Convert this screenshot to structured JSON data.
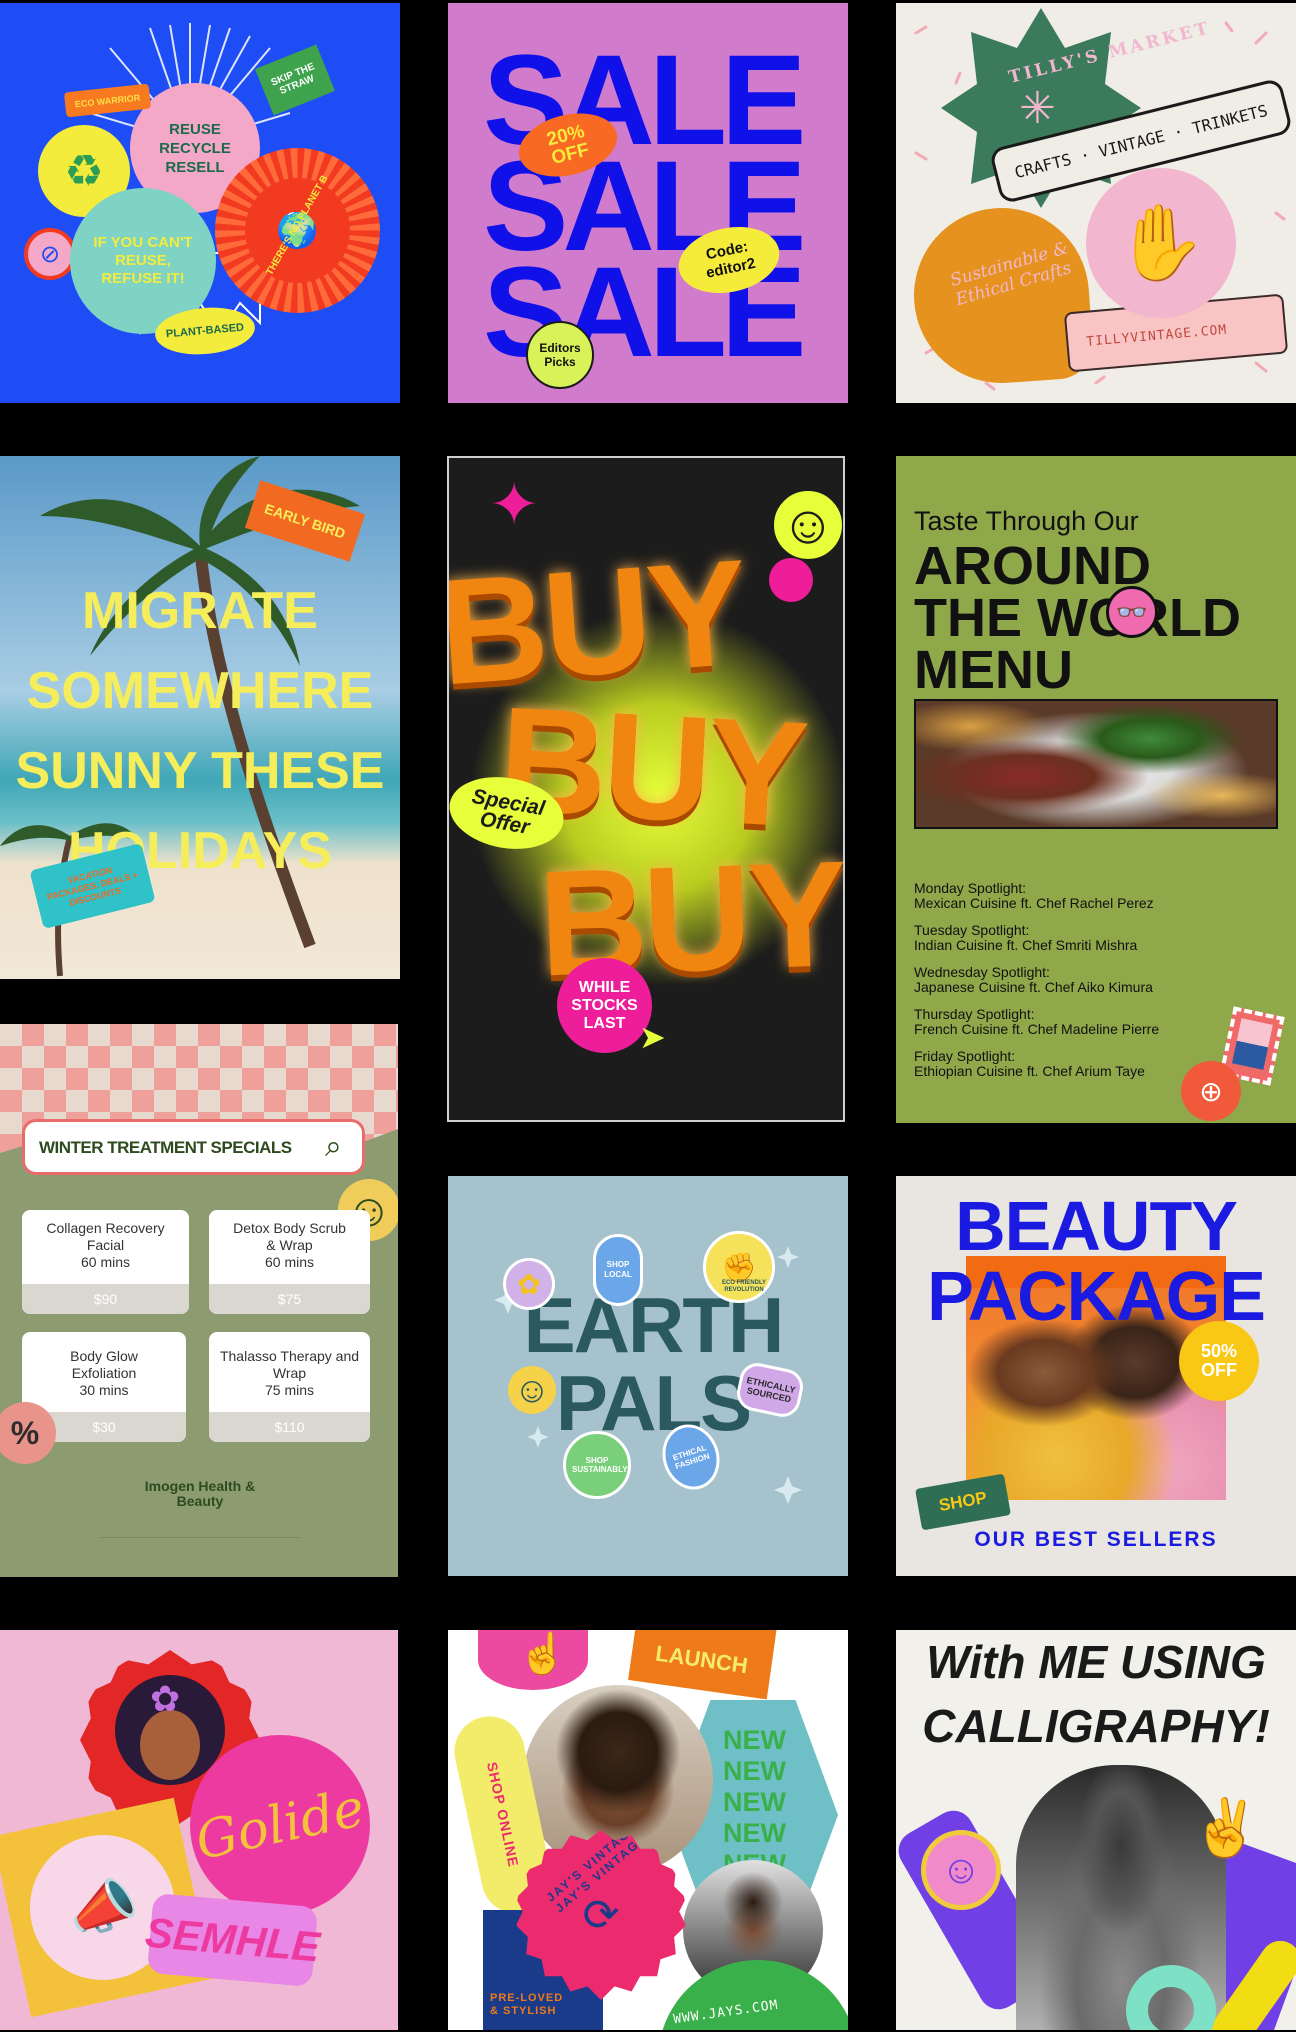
{
  "eco": {
    "colors": {
      "bg": "#1e4cf5",
      "pink": "#f4a8c8",
      "teal": "#7fd3c4",
      "red": "#f23a21",
      "yellow": "#f4ec3c"
    },
    "eco_warrior": "ECO WARRIOR",
    "skip_straw": "SKIP THE STRAW",
    "reuse": "REUSE RECYCLE RESELL",
    "refuse": "IF YOU CAN'T REUSE, REFUSE IT!",
    "no_planet": "THERE'S NO PLANET B",
    "plant_based": "PLANT-BASED"
  },
  "sale": {
    "colors": {
      "bg": "#d07bcc",
      "blue": "#1010e8",
      "orange": "#f86a24",
      "yellow": "#f5eb3a",
      "lime": "#d9f25a"
    },
    "lines": [
      "SALE",
      "SALE",
      "SALE"
    ],
    "discount": "20% OFF",
    "code": "Code: editor2",
    "picks": "Editors Picks"
  },
  "tilly": {
    "colors": {
      "bg": "#efede6",
      "green": "#3c7a5c",
      "orange": "#e6921e",
      "pink": "#f2b6cf"
    },
    "market": "TILLY'S MARKET",
    "tagline": "CRAFTS · VINTAGE · TRINKETS",
    "sustainable": "Sustainable & Ethical Crafts",
    "url": "TILLYVINTAGE.COM"
  },
  "migrate": {
    "colors": {
      "sky": "#7fb3d6",
      "sea": "#3fa7b6",
      "sand": "#efe2cc",
      "text": "#f5ee5a"
    },
    "early_bird": "EARLY BIRD",
    "lines": [
      "MIGRATE",
      "SOMEWHERE",
      "SUNNY THESE",
      "HOLIDAYS"
    ],
    "packages": "VACATION PACKAGES, DEALS + DISCOUNTS"
  },
  "buy": {
    "colors": {
      "bg": "#1c1c1c",
      "orange": "#f0860f",
      "pink": "#ee1e9a",
      "lime": "#e6ff3a"
    },
    "lines": [
      "BUY",
      "BUY",
      "BUY"
    ],
    "special": "Special Offer",
    "stocks": "WHILE STOCKS LAST"
  },
  "menu": {
    "colors": {
      "bg": "#8fa84a",
      "text": "#111111"
    },
    "subtitle": "Taste Through Our",
    "title_lines": [
      "AROUND",
      "THE WORLD",
      "MENU"
    ],
    "spotlights": [
      {
        "day": "Monday Spotlight:",
        "detail": "Mexican Cuisine ft. Chef Rachel Perez"
      },
      {
        "day": "Tuesday Spotlight:",
        "detail": "Indian Cuisine ft. Chef Smriti Mishra"
      },
      {
        "day": "Wednesday Spotlight:",
        "detail": "Japanese Cuisine ft. Chef Aiko Kimura"
      },
      {
        "day": "Thursday Spotlight:",
        "detail": "French Cuisine ft. Chef Madeline Pierre"
      },
      {
        "day": "Friday Spotlight:",
        "detail": "Ethiopian Cuisine ft. Chef Arium Taye"
      }
    ]
  },
  "winter": {
    "colors": {
      "bg": "#8c9b70",
      "check1": "#f0a09a",
      "check2": "#e8d9cf",
      "green": "#2d4b1e"
    },
    "search_text": "WINTER TREATMENT SPECIALS",
    "treatments": [
      {
        "name": "Collagen Recovery Facial",
        "duration": "60 mins",
        "price": "$90"
      },
      {
        "name": "Detox Body Scrub & Wrap",
        "duration": "60 mins",
        "price": "$75"
      },
      {
        "name": "Body Glow Exfoliation",
        "duration": "30 mins",
        "price": "$30"
      },
      {
        "name": "Thalasso Therapy and Wrap",
        "duration": "75 mins",
        "price": "$110"
      }
    ],
    "percent": "%",
    "brand": "Imogen Health & Beauty"
  },
  "earth": {
    "colors": {
      "bg": "#a6c2cc",
      "text": "#2a5a60"
    },
    "title_lines": [
      "EARTH",
      "PALS"
    ],
    "shop_local": "SHOP LOCAL",
    "revolution": "ECO FRIENDLY REVOLUTION",
    "ethically": "ETHICALLY SOURCED",
    "sustainably": "SHOP SUSTAINABLY",
    "fashion": "ETHICAL FASHION"
  },
  "beauty": {
    "colors": {
      "bg": "#e9e6e1",
      "blue": "#1a1ae0",
      "orange": "#f26a12",
      "yellow": "#f8c814",
      "green": "#2f6e55"
    },
    "title_lines": [
      "BEAUTY",
      "PACKAGE"
    ],
    "discount": "50% OFF",
    "shop": "SHOP",
    "bestsellers": "OUR BEST SELLERS"
  },
  "golide": {
    "colors": {
      "bg": "#f0b8d4",
      "red": "#e32626",
      "pink": "#ec3aa0",
      "yellow": "#f4c23a",
      "violet": "#e987e6"
    },
    "golide": "Golide",
    "semhle": "SEMHLE"
  },
  "jays": {
    "colors": {
      "bg": "#ffffff",
      "pink": "#ec2a6e",
      "teal": "#6ebfc6",
      "yellow": "#f3ec6a",
      "green": "#3ab04a",
      "orange": "#ef7a1a"
    },
    "launch": "LAUNCH",
    "shop_online": "SHOP ONLINE",
    "new": [
      "NEW",
      "NEW",
      "NEW",
      "NEW",
      "NEW"
    ],
    "badge": "JAY'S VINTAGE · JAY'S VINTAGE ·",
    "preloved": "PRE-LOVED & STYLISH",
    "url": "WWW.JAYS.COM"
  },
  "callig": {
    "colors": {
      "bg": "#f1f0ea",
      "violet": "#7040e6",
      "yellow": "#f2dc14",
      "mint": "#7ee0c4"
    },
    "lines": [
      "With ME USING",
      "CALLIGRAPHY!"
    ]
  }
}
